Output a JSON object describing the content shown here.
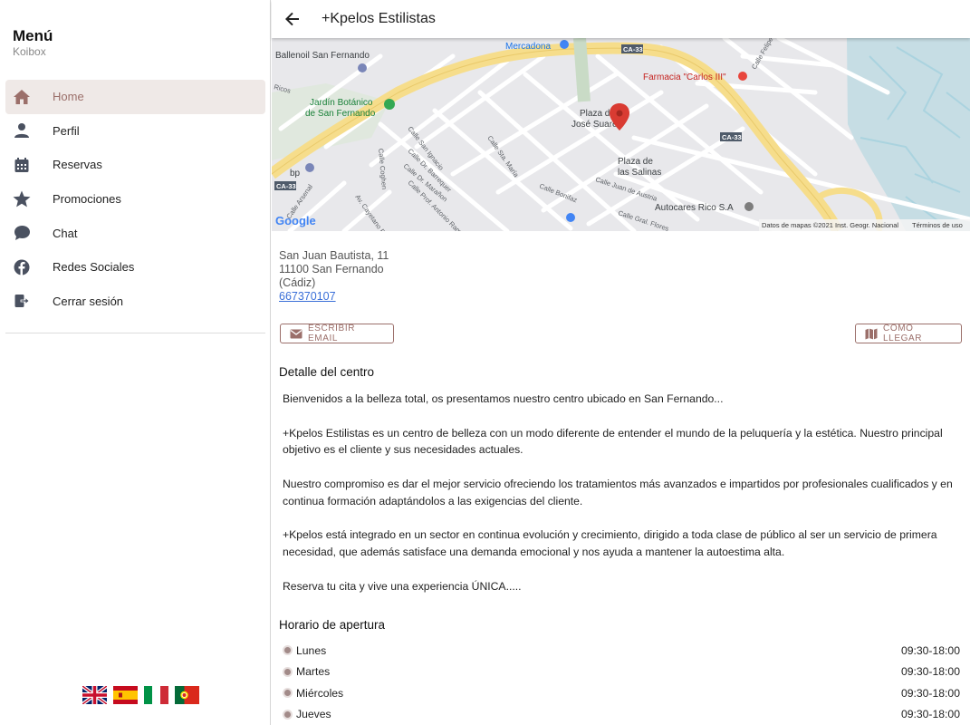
{
  "sidebar": {
    "title": "Menú",
    "subtitle": "Koibox",
    "items": [
      {
        "label": "Home",
        "icon": "home-icon"
      },
      {
        "label": "Perfil",
        "icon": "person-icon"
      },
      {
        "label": "Reservas",
        "icon": "calendar-icon"
      },
      {
        "label": "Promociones",
        "icon": "star-icon"
      },
      {
        "label": "Chat",
        "icon": "chat-icon"
      },
      {
        "label": "Redes Sociales",
        "icon": "facebook-icon"
      },
      {
        "label": "Cerrar sesión",
        "icon": "logout-icon"
      }
    ],
    "flags": [
      "uk-flag",
      "spain-flag",
      "italy-flag",
      "portugal-flag"
    ]
  },
  "header": {
    "title": "+Kpelos Estilistas"
  },
  "map": {
    "labels": {
      "mercadona": "Mercadona",
      "ballenoil": "Ballenoil San Fernando",
      "farmacia": "Farmacia \"Carlos III\"",
      "jardin1": "Jardín Botánico",
      "jardin2": "de San Fernando",
      "plaza1": "Plaza de",
      "plaza2": "José Suarez",
      "salinas1": "Plaza de",
      "salinas2": "las Salinas",
      "autocares": "Autocares Rico S.A",
      "bp": "bp",
      "ca33a": "CA-33",
      "ca33b": "CA-33",
      "ca33c": "CA-33",
      "google": "Google",
      "attribution": "Datos de mapas ©2021 Inst. Geogr. Nacional",
      "terms": "Términos de uso",
      "st_ignacio": "Calle San Ignacio",
      "st_maria": "Calle Sta. María",
      "st_coghen": "Calle Coghen",
      "st_barrequer": "Calle Dr. Barrequer",
      "st_maranon": "Calle Dr. Marañon",
      "st_ramon": "Calle Prof. Antonio Ramos",
      "st_bonifaz": "Calle Bonifaz",
      "st_austria": "Calle Juan de Austria",
      "st_flores": "Calle Gral. Flores",
      "st_cayetano": "Av. Cayetano Roldán",
      "st_felipe": "Calle Felipe",
      "st_arsenal": "Calle Arsenal",
      "st_mucos": "Ricos"
    }
  },
  "address": {
    "line1": "San Juan Bautista, 11",
    "line2": "11100 San Fernando",
    "line3": "(Cádiz)",
    "phone": "667370107"
  },
  "buttons": {
    "email": "ESCRIBIR EMAIL",
    "directions": "COMO LLEGAR"
  },
  "detail": {
    "heading": "Detalle del centro",
    "paragraphs": [
      "Bienvenidos a la belleza total, os presentamos nuestro centro ubicado en San Fernando...",
      "+Kpelos Estilistas es un centro de belleza con un modo diferente de entender el mundo de la peluquería y la estética. Nuestro principal objetivo es el cliente y sus necesidades actuales.",
      "Nuestro compromiso es dar el mejor servicio ofreciendo los tratamientos más avanzados e impartidos por profesionales cualificados y en continua formación adaptándolos a las exigencias del cliente.",
      "+Kpelos está integrado en un sector en continua evolución y crecimiento, dirigido a toda clase de público al ser un servicio de primera necesidad, que además satisface una demanda emocional y nos ayuda a mantener la autoestima alta.",
      "Reserva tu cita y vive una experiencia ÚNICA....."
    ]
  },
  "schedule": {
    "heading": "Horario de apertura",
    "rows": [
      {
        "day": "Lunes",
        "hours": "09:30-18:00"
      },
      {
        "day": "Martes",
        "hours": "09:30-18:00"
      },
      {
        "day": "Miércoles",
        "hours": "09:30-18:00"
      },
      {
        "day": "Jueves",
        "hours": "09:30-18:00"
      }
    ]
  },
  "colors": {
    "accent": "#9b6f6a",
    "active_bg": "#efe9e7",
    "link": "#3a6fd8",
    "pin": "#d93b32",
    "road_major": "#f6dd8b"
  }
}
